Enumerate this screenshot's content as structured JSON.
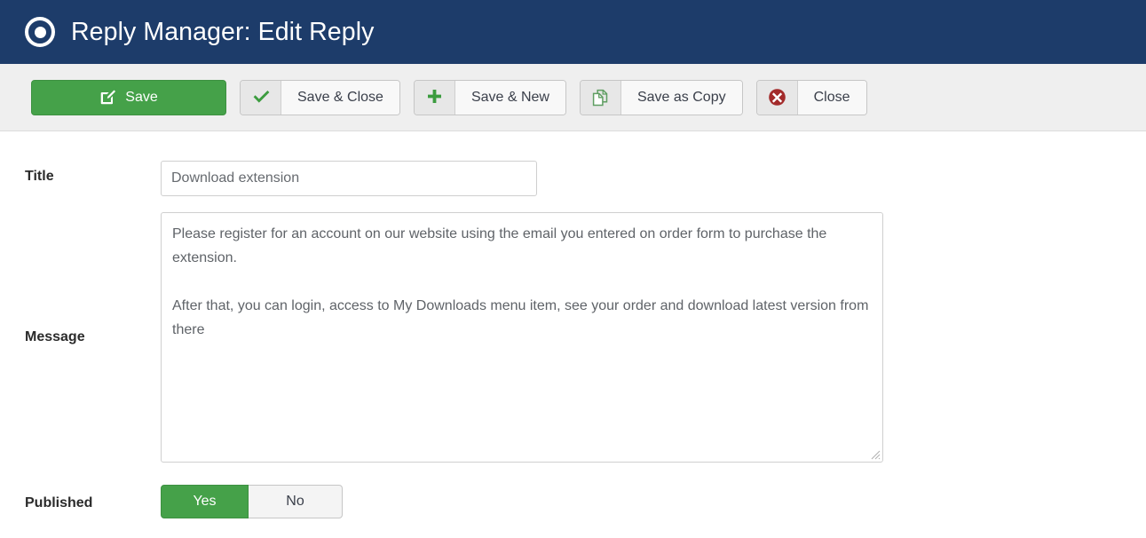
{
  "header": {
    "icon": "target-circle-icon",
    "title": "Reply Manager: Edit Reply",
    "bg_color": "#1d3c6a"
  },
  "toolbar": {
    "save_label": "Save",
    "save_icon": "edit-square-icon",
    "save_close_label": "Save & Close",
    "save_close_icon": "check-icon",
    "save_new_label": "Save & New",
    "save_new_icon": "plus-icon",
    "save_copy_label": "Save as Copy",
    "save_copy_icon": "copy-pages-icon",
    "close_label": "Close",
    "close_icon": "circle-x-icon",
    "accent_green": "#45a149",
    "close_red": "#a32b2b",
    "bg_color": "#efefef"
  },
  "form": {
    "title_label": "Title",
    "title_value": "Download extension",
    "title_placeholder": "",
    "message_label": "Message",
    "message_value": "Please register for an account on our website using the email you entered on order form to purchase the extension.\n\nAfter that, you can login, access to My Downloads menu item, see your order and download latest version from there",
    "message_placeholder": "",
    "published_label": "Published",
    "published_yes": "Yes",
    "published_no": "No",
    "published_selected": "Yes"
  }
}
